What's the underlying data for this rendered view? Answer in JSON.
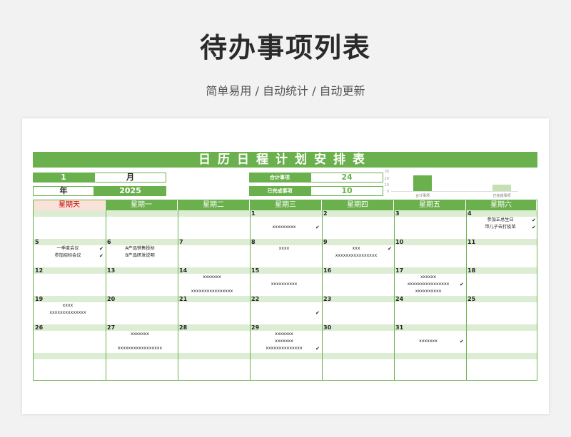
{
  "header": {
    "title": "待办事项列表",
    "subtitle": "简单易用 / 自动统计 / 自动更新"
  },
  "sheet": {
    "banner": "日历日程计划安排表",
    "month_value": "1",
    "month_label": "月",
    "year_label": "年",
    "year_value": "2025",
    "total_label": "合计事项",
    "total_value": "24",
    "done_label": "已完成事项",
    "done_value": "10"
  },
  "mini_chart": {
    "y_ticks": [
      "30",
      "20",
      "10",
      "0"
    ],
    "categories": [
      "合计事项",
      "已完成事项"
    ],
    "values": [
      24,
      10
    ],
    "ylim": [
      0,
      30
    ],
    "colors": [
      "#6ab04c",
      "#c6e0b4"
    ]
  },
  "weekdays": [
    "星期天",
    "星期一",
    "星期二",
    "星期三",
    "星期四",
    "星期五",
    "星期六"
  ],
  "weeks": [
    [
      {
        "day": "",
        "items": []
      },
      {
        "day": "",
        "items": []
      },
      {
        "day": "",
        "items": []
      },
      {
        "day": "1",
        "items": [
          {
            "text": "",
            "check": ""
          },
          {
            "text": "xxxxxxxxx",
            "check": "✔"
          }
        ]
      },
      {
        "day": "2",
        "items": []
      },
      {
        "day": "3",
        "items": []
      },
      {
        "day": "4",
        "items": [
          {
            "text": "参加王总生日",
            "check": "✔"
          },
          {
            "text": "带儿子去打疫苗",
            "check": "✔"
          }
        ]
      }
    ],
    [
      {
        "day": "5",
        "items": [
          {
            "text": "一季度会议",
            "check": "✔"
          },
          {
            "text": "参加招标会议",
            "check": "✔"
          }
        ]
      },
      {
        "day": "6",
        "items": [
          {
            "text": "A产品销售投标",
            "check": ""
          },
          {
            "text": "B产品研发说明",
            "check": ""
          }
        ]
      },
      {
        "day": "7",
        "items": []
      },
      {
        "day": "8",
        "items": [
          {
            "text": "xxxx",
            "check": ""
          }
        ]
      },
      {
        "day": "9",
        "items": [
          {
            "text": "xxx",
            "check": "✔"
          },
          {
            "text": "xxxxxxxxxxxxxxxx",
            "check": ""
          }
        ]
      },
      {
        "day": "10",
        "items": []
      },
      {
        "day": "11",
        "items": []
      }
    ],
    [
      {
        "day": "12",
        "items": []
      },
      {
        "day": "13",
        "items": []
      },
      {
        "day": "14",
        "items": [
          {
            "text": "xxxxxxx",
            "check": ""
          },
          {
            "text": "",
            "check": ""
          },
          {
            "text": "xxxxxxxxxxxxxxxx",
            "check": ""
          }
        ]
      },
      {
        "day": "15",
        "items": [
          {
            "text": "",
            "check": ""
          },
          {
            "text": "xxxxxxxxxx",
            "check": ""
          }
        ]
      },
      {
        "day": "16",
        "items": []
      },
      {
        "day": "17",
        "items": [
          {
            "text": "xxxxxx",
            "check": ""
          },
          {
            "text": "xxxxxxxxxxxxxxxx",
            "check": "✔"
          },
          {
            "text": "xxxxxxxxxx",
            "check": ""
          }
        ]
      },
      {
        "day": "18",
        "items": []
      }
    ],
    [
      {
        "day": "19",
        "items": [
          {
            "text": "xxxx",
            "check": ""
          },
          {
            "text": "xxxxxxxxxxxxxx",
            "check": ""
          }
        ]
      },
      {
        "day": "20",
        "items": []
      },
      {
        "day": "21",
        "items": []
      },
      {
        "day": "22",
        "items": [
          {
            "text": "",
            "check": ""
          },
          {
            "text": "",
            "check": "✔"
          }
        ]
      },
      {
        "day": "23",
        "items": []
      },
      {
        "day": "24",
        "items": []
      },
      {
        "day": "25",
        "items": []
      }
    ],
    [
      {
        "day": "26",
        "items": []
      },
      {
        "day": "27",
        "items": [
          {
            "text": "xxxxxxx",
            "check": ""
          },
          {
            "text": "",
            "check": ""
          },
          {
            "text": "xxxxxxxxxxxxxxxxx",
            "check": ""
          }
        ]
      },
      {
        "day": "28",
        "items": []
      },
      {
        "day": "29",
        "items": [
          {
            "text": "xxxxxxx",
            "check": ""
          },
          {
            "text": "xxxxxxx",
            "check": ""
          },
          {
            "text": "xxxxxxxxxxxxxx",
            "check": "✔"
          }
        ]
      },
      {
        "day": "30",
        "items": []
      },
      {
        "day": "31",
        "items": [
          {
            "text": "",
            "check": ""
          },
          {
            "text": "xxxxxxx",
            "check": "✔"
          }
        ]
      },
      {
        "day": "",
        "items": []
      }
    ]
  ]
}
